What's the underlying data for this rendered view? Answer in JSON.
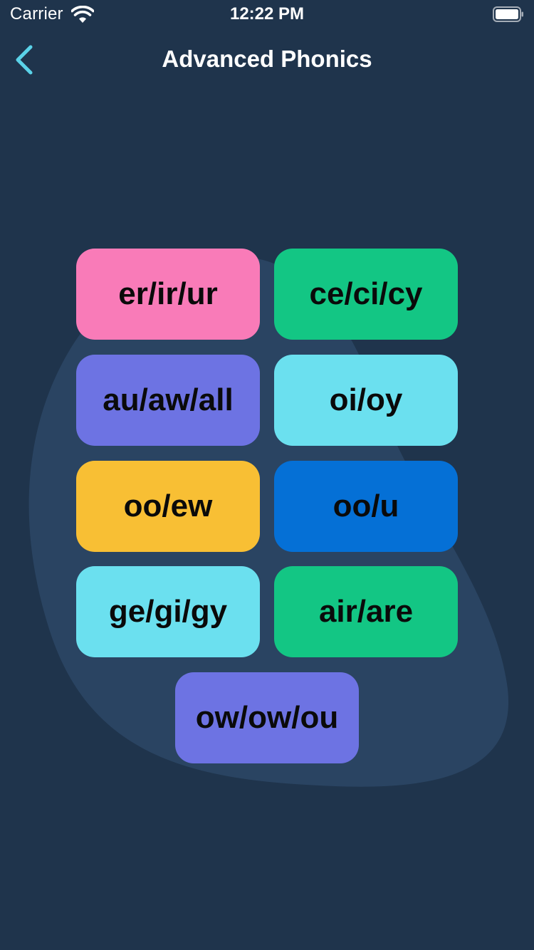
{
  "status_bar": {
    "carrier": "Carrier",
    "time": "12:22 PM"
  },
  "nav": {
    "title": "Advanced Phonics",
    "back_icon": "chevron-left-icon"
  },
  "colors": {
    "background": "#1f344c",
    "blob": "#2a4462",
    "accent": "#5ad2e8"
  },
  "tiles": [
    {
      "label": "er/ir/ur",
      "color": "#f97bb8"
    },
    {
      "label": "ce/ci/cy",
      "color": "#13c684"
    },
    {
      "label": "au/aw/all",
      "color": "#6d73e3"
    },
    {
      "label": "oi/oy",
      "color": "#6be0ef"
    },
    {
      "label": "oo/ew",
      "color": "#f8bf34"
    },
    {
      "label": "oo/u",
      "color": "#0570d6"
    },
    {
      "label": "ge/gi/gy",
      "color": "#6be0ef"
    },
    {
      "label": "air/are",
      "color": "#13c684"
    },
    {
      "label": "ow/ow/ou",
      "color": "#6d73e3"
    }
  ]
}
